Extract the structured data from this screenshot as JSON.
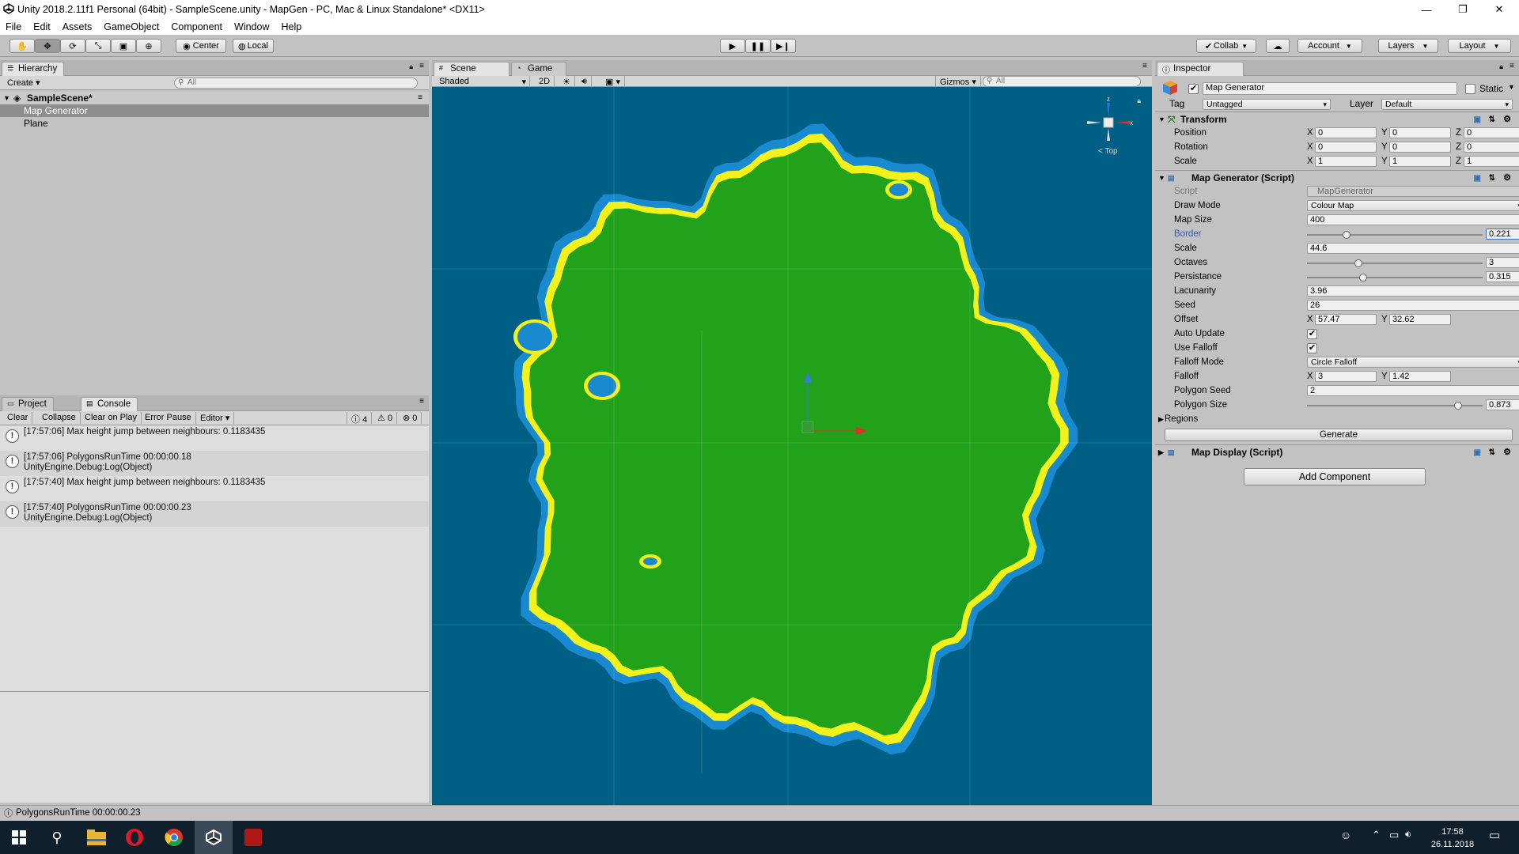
{
  "window": {
    "title": "Unity 2018.2.11f1 Personal (64bit) - SampleScene.unity - MapGen - PC, Mac & Linux Standalone* <DX11>",
    "controls": [
      "—",
      "❐",
      "✕"
    ]
  },
  "menu": [
    "File",
    "Edit",
    "Assets",
    "GameObject",
    "Component",
    "Window",
    "Help"
  ],
  "toolbar": {
    "pivot": "Center",
    "space": "Local",
    "collab": "Collab",
    "account": "Account",
    "layers": "Layers",
    "layout": "Layout"
  },
  "hierarchy": {
    "tab": "Hierarchy",
    "create": "Create",
    "search_placeholder": "All",
    "scene": "SampleScene*",
    "items": [
      "Map Generator",
      "Plane"
    ]
  },
  "console": {
    "tabs": [
      "Project",
      "Console"
    ],
    "buttons": [
      "Clear",
      "Collapse",
      "Clear on Play",
      "Error Pause",
      "Editor"
    ],
    "counts": {
      "info": "4",
      "warn": "0",
      "error": "0"
    },
    "logs": [
      {
        "line1": "[17:57:06] Max height jump between neighbours: 0.1183435",
        "line2": ""
      },
      {
        "line1": "[17:57:06] PolygonsRunTime 00:00:00.18",
        "line2": "UnityEngine.Debug:Log(Object)"
      },
      {
        "line1": "[17:57:40] Max height jump between neighbours: 0.1183435",
        "line2": ""
      },
      {
        "line1": "[17:57:40] PolygonsRunTime 00:00:00.23",
        "line2": "UnityEngine.Debug:Log(Object)"
      }
    ]
  },
  "scene": {
    "tabs": [
      "Scene",
      "Game"
    ],
    "shading": "Shaded",
    "mode2d": "2D",
    "gizmos": "Gizmos",
    "search_placeholder": "All",
    "gizmo_label": "Top",
    "gizmo_axes": {
      "x": "x",
      "z": "z"
    },
    "colors": {
      "water": "#005f84",
      "shallow": "#1a8ad0",
      "sand": "#f2f21a",
      "land": "#22a11a"
    }
  },
  "inspector": {
    "tab": "Inspector",
    "object_name": "Map Generator",
    "static_label": "Static",
    "tag_label": "Tag",
    "tag_value": "Untagged",
    "layer_label": "Layer",
    "layer_value": "Default",
    "transform": {
      "title": "Transform",
      "rows": [
        {
          "label": "Position",
          "x": "0",
          "y": "0",
          "z": "0"
        },
        {
          "label": "Rotation",
          "x": "0",
          "y": "0",
          "z": "0"
        },
        {
          "label": "Scale",
          "x": "1",
          "y": "1",
          "z": "1"
        }
      ]
    },
    "map_generator": {
      "title": "Map Generator (Script)",
      "script_label": "Script",
      "script_value": "MapGenerator",
      "draw_mode_label": "Draw Mode",
      "draw_mode_value": "Colour Map",
      "map_size_label": "Map Size",
      "map_size_value": "400",
      "border_label": "Border",
      "border_value": "0.221",
      "border_level": 0.221,
      "scale_label": "Scale",
      "scale_value": "44.6",
      "octaves_label": "Octaves",
      "octaves_value": "3",
      "persistance_label": "Persistance",
      "persistance_value": "0.315",
      "lacunarity_label": "Lacunarity",
      "lacunarity_value": "3.96",
      "seed_label": "Seed",
      "seed_value": "26",
      "offset_label": "Offset",
      "offset_x": "57.47",
      "offset_y": "32.62",
      "auto_update_label": "Auto Update",
      "use_falloff_label": "Use Falloff",
      "falloff_mode_label": "Falloff Mode",
      "falloff_mode_value": "Circle Falloff",
      "falloff_label": "Falloff",
      "falloff_x": "3",
      "falloff_y": "1.42",
      "polygon_seed_label": "Polygon Seed",
      "polygon_seed_value": "2",
      "polygon_size_label": "Polygon Size",
      "polygon_size_value": "0.873",
      "polygon_size_level": 0.873,
      "regions_label": "Regions",
      "generate_label": "Generate"
    },
    "map_display": {
      "title": "Map Display (Script)"
    },
    "add_component": "Add Component"
  },
  "status": "PolygonsRunTime 00:00:00.23",
  "taskbar": {
    "time": "17:58",
    "date": "26.11.2018"
  }
}
